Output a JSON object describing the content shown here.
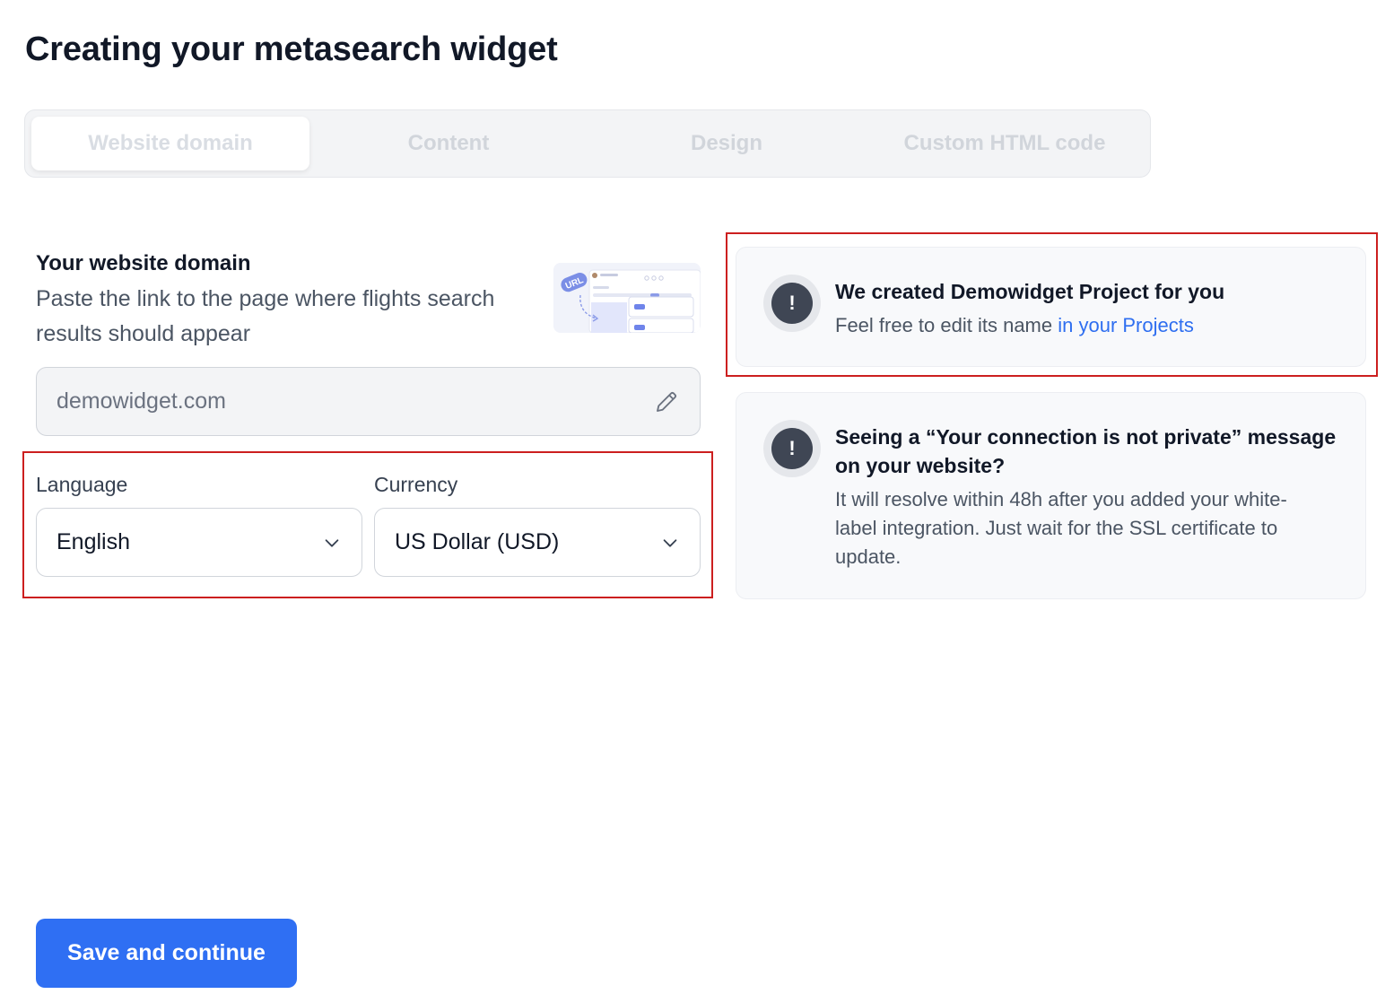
{
  "page": {
    "title": "Creating your metasearch widget"
  },
  "steps": [
    {
      "label": "Website domain",
      "active": true
    },
    {
      "label": "Content",
      "active": false
    },
    {
      "label": "Design",
      "active": false
    },
    {
      "label": "Custom HTML code",
      "active": false
    }
  ],
  "domain_section": {
    "title": "Your website domain",
    "description": "Paste the link to the page where flights search results should appear",
    "illustration_badge": "URL",
    "input_value": "demowidget.com"
  },
  "language": {
    "label": "Language",
    "value": "English"
  },
  "currency": {
    "label": "Currency",
    "value": "US Dollar (USD)"
  },
  "info_project": {
    "icon": "!",
    "title": "We created Demowidget Project for you",
    "text": "Feel free to edit its name ",
    "link": "in your Projects"
  },
  "info_ssl": {
    "icon": "!",
    "title": "Seeing a “Your connection is not private” message on your website?",
    "text": "It will resolve within 48h after you added your white-label integration. Just wait for the SSL certificate to update."
  },
  "actions": {
    "save_label": "Save and continue"
  },
  "colors": {
    "primary": "#2f6ff3",
    "link": "#2e6ef0",
    "highlight": "#cc1f1f"
  }
}
